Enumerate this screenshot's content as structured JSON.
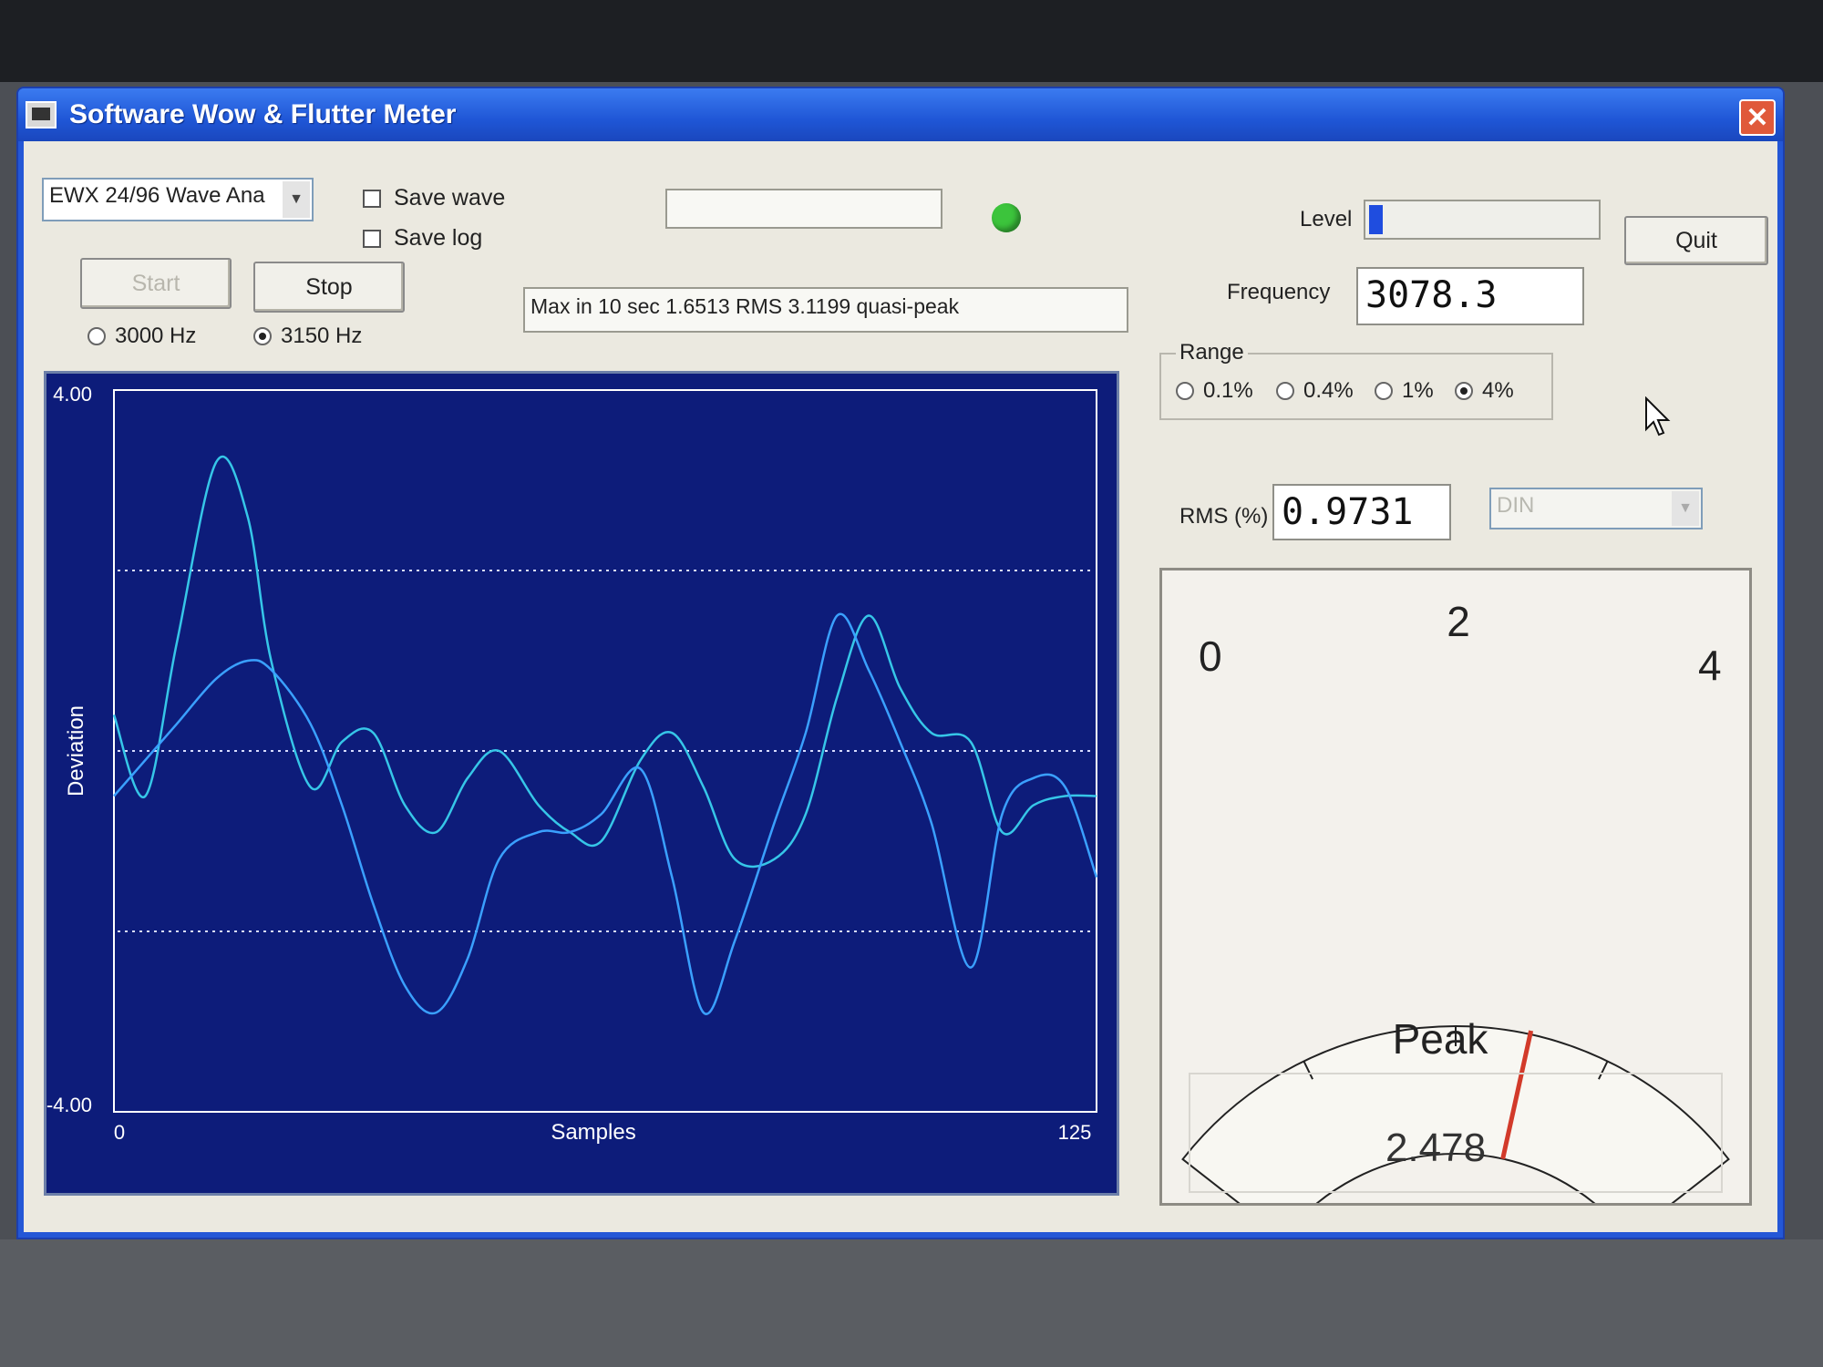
{
  "window": {
    "title": "Software Wow & Flutter Meter",
    "close_glyph": "✕"
  },
  "controls": {
    "device_select": "EWX 24/96 Wave Ana",
    "save_wave_label": "Save wave",
    "save_log_label": "Save log",
    "start_label": "Start",
    "stop_label": "Stop",
    "freq_option_a": "3000 Hz",
    "freq_option_b": "3150 Hz",
    "freq_selected": "3150 Hz",
    "status_message": "Max in 10 sec 1.6513 RMS 3.1199 quasi-peak",
    "indicator_color": "#3cc43c",
    "level_label": "Level",
    "level_fraction": 0.06,
    "quit_label": "Quit",
    "frequency_label": "Frequency",
    "frequency_value": "3078.3",
    "range_label": "Range",
    "range_options": [
      "0.1%",
      "0.4%",
      "1%",
      "4%"
    ],
    "range_selected": "4%",
    "rms_label": "RMS (%)",
    "rms_value": "0.9731",
    "weighting_select": "DIN"
  },
  "plot": {
    "ymax_label": "4.00",
    "ymin_label": "-4.00",
    "ylabel": "Deviation",
    "xlabel": "Samples",
    "xmin_label": "0",
    "xmax_label": "125",
    "colors": {
      "background": "#0d1c7a",
      "trace_a": "#36c6e8",
      "trace_b": "#3aa0ff",
      "grid": "#d8dcff"
    }
  },
  "chart_data": {
    "type": "line",
    "xlabel": "Samples",
    "ylabel": "Deviation",
    "xlim": [
      0,
      125
    ],
    "ylim": [
      -4,
      4
    ],
    "grid_lines_y": [
      2,
      0,
      -2
    ],
    "x": [
      0,
      4,
      8,
      13,
      17,
      20,
      25,
      29,
      33,
      37,
      41,
      45,
      49,
      54,
      58,
      62,
      67,
      71,
      75,
      79,
      84,
      88,
      92,
      96,
      100,
      104,
      109,
      113,
      117,
      121,
      125
    ],
    "series": [
      {
        "values": [
          0.4,
          -0.5,
          1.2,
          3.2,
          2.6,
          1.0,
          -0.4,
          0.1,
          0.2,
          -0.6,
          -0.9,
          -0.3,
          0.0,
          -0.6,
          -0.9,
          -1.0,
          -0.1,
          0.2,
          -0.4,
          -1.2,
          -1.2,
          -0.7,
          0.6,
          1.5,
          0.7,
          0.2,
          0.1,
          -0.9,
          -0.6,
          -0.5,
          -0.5
        ]
      },
      {
        "values": [
          -0.5,
          -0.1,
          0.3,
          0.8,
          1.0,
          0.9,
          0.3,
          -0.6,
          -1.7,
          -2.6,
          -2.9,
          -2.3,
          -1.2,
          -0.9,
          -0.9,
          -0.7,
          -0.2,
          -1.4,
          -2.9,
          -2.1,
          -0.8,
          0.2,
          1.5,
          0.9,
          0.1,
          -0.8,
          -2.4,
          -0.7,
          -0.3,
          -0.4,
          -1.4
        ]
      }
    ]
  },
  "meter": {
    "scale_min": "0",
    "scale_mid": "2",
    "scale_max": "4",
    "scale_range": [
      0,
      4
    ],
    "needle_value": 2.478,
    "peak_label": "Peak",
    "peak_value": "2.478",
    "needle_color": "#d23a2a"
  }
}
